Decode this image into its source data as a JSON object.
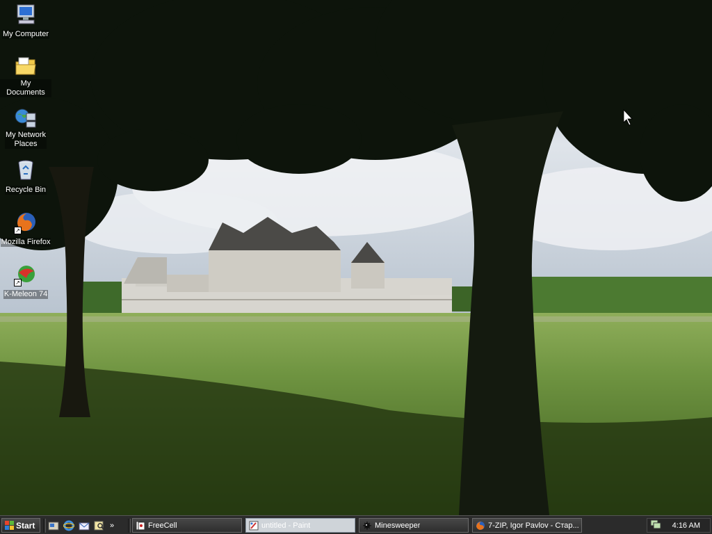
{
  "desktop": {
    "icons": [
      {
        "label": "My Computer",
        "icon": "computer-icon"
      },
      {
        "label": "My Documents",
        "icon": "folder-icon"
      },
      {
        "label": "My Network",
        "label2": "Places",
        "icon": "network-icon"
      },
      {
        "label": "Recycle Bin",
        "icon": "recycle-bin-icon"
      },
      {
        "label": "Mozilla Firefox",
        "icon": "firefox-icon"
      },
      {
        "label": "K-Meleon 74",
        "icon": "k-meleon-icon"
      }
    ]
  },
  "taskbar": {
    "start_label": "Start",
    "quick_launch": [
      "show-desktop-icon",
      "internet-explorer-icon",
      "outlook-express-icon",
      "search-icon"
    ],
    "more_label": "»",
    "tasks": [
      {
        "label": "FreeCell",
        "active": false
      },
      {
        "label": "untitled - Paint",
        "active": true
      },
      {
        "label": "Minesweeper",
        "active": false
      },
      {
        "label": "7-ZIP, Igor Pavlov - Стар...",
        "active": false
      }
    ],
    "clock": "4:16 AM"
  },
  "colors": {
    "taskbar": "#2b2b2b",
    "active_task": "#cfd4d9",
    "sky": "#c9d3de",
    "grass": "#6f9441"
  }
}
